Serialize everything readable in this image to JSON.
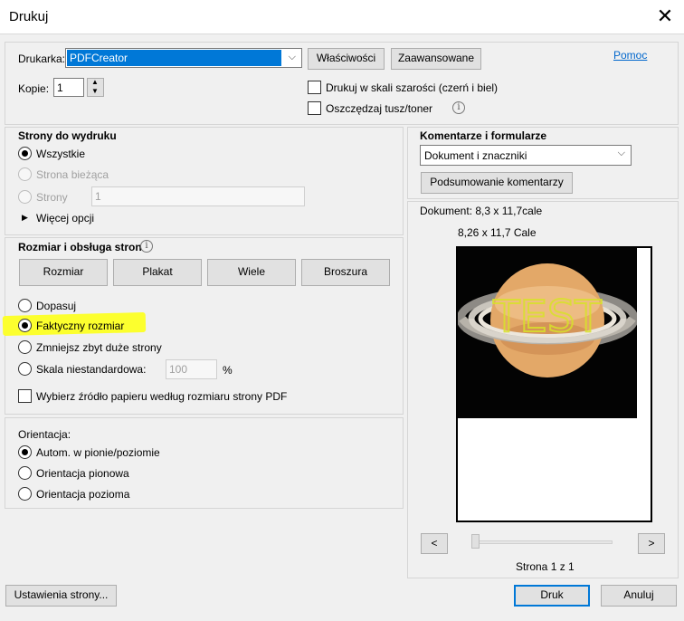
{
  "window": {
    "title": "Drukuj",
    "close_glyph": "✕"
  },
  "printer": {
    "label": "Drukarka:",
    "selected": "PDFCreator",
    "properties_button": "Właściwości",
    "advanced_button": "Zaawansowane",
    "help_link": "Pomoc",
    "copies_label": "Kopie:",
    "copies_value": "1",
    "grayscale_label": "Drukuj w skali szarości (czerń i biel)",
    "save_ink_label": "Oszczędzaj tusz/toner"
  },
  "pages_to_print": {
    "heading": "Strony do wydruku",
    "all": "Wszystkie",
    "current": "Strona bieżąca",
    "pages": "Strony",
    "pages_value": "1",
    "more_options": "Więcej opcji"
  },
  "page_sizing": {
    "heading": "Rozmiar i obsługa stron",
    "tabs": [
      "Rozmiar",
      "Plakat",
      "Wiele",
      "Broszura"
    ],
    "fit": "Dopasuj",
    "actual_size": "Faktyczny rozmiar",
    "shrink": "Zmniejsz zbyt duże strony",
    "custom_scale": "Skala niestandardowa:",
    "custom_scale_value": "100",
    "percent": "%",
    "paper_source": "Wybierz źródło papieru według rozmiaru strony PDF"
  },
  "orientation": {
    "heading": "Orientacja:",
    "auto": "Autom. w pionie/poziomie",
    "portrait": "Orientacja pionowa",
    "landscape": "Orientacja pozioma"
  },
  "comments": {
    "heading": "Komentarze i formularze",
    "selected": "Dokument i znaczniki",
    "summarize_button": "Podsumowanie komentarzy"
  },
  "preview": {
    "document_size": "Dokument: 8,3 x 11,7cale",
    "paper_size": "8,26 x 11,7 Cale",
    "prev": "<",
    "next": ">",
    "page_indicator": "Strona 1 z 1",
    "watermark": "TEST"
  },
  "footer": {
    "page_setup": "Ustawienia strony...",
    "print": "Druk",
    "cancel": "Anuluj"
  },
  "colors": {
    "accent": "#0078d7",
    "highlight": "#fcff2e"
  }
}
